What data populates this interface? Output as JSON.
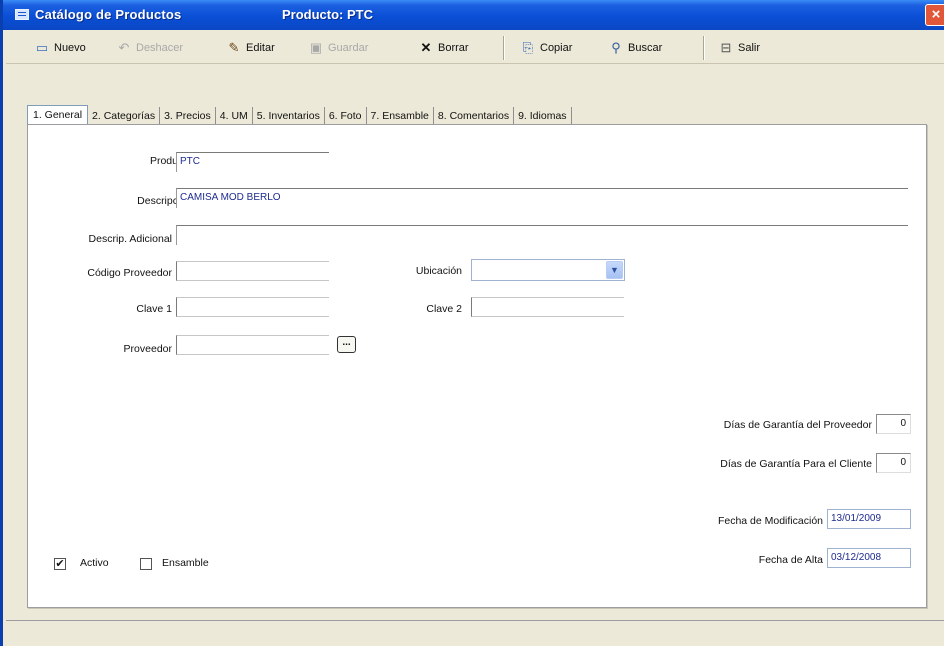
{
  "window": {
    "title": "Catálogo de Productos",
    "product_title": "Producto: PTC",
    "close_glyph": "×"
  },
  "toolbar": {
    "nuevo": "Nuevo",
    "deshacer": "Deshacer",
    "editar": "Editar",
    "guardar": "Guardar",
    "borrar": "Borrar",
    "copiar": "Copiar",
    "buscar": "Buscar",
    "salir": "Salir"
  },
  "tabs": [
    {
      "label": "1. General"
    },
    {
      "label": "2. Categorías"
    },
    {
      "label": "3. Precios"
    },
    {
      "label": "4. UM"
    },
    {
      "label": "5. Inventarios"
    },
    {
      "label": "6. Foto"
    },
    {
      "label": "7. Ensamble"
    },
    {
      "label": "8. Comentarios"
    },
    {
      "label": "9. Idiomas"
    }
  ],
  "form": {
    "producto_label": "Producto",
    "producto_value": "PTC",
    "descripcion_label": "Descripción",
    "descripcion_value": "CAMISA MOD BERLO",
    "descrip_adicional_label": "Descrip. Adicional",
    "descrip_adicional_value": "",
    "codigo_proveedor_label": "Código Proveedor",
    "codigo_proveedor_value": "",
    "ubicacion_label": "Ubicación",
    "ubicacion_value": "",
    "clave1_label": "Clave 1",
    "clave1_value": "",
    "clave2_label": "Clave 2",
    "clave2_value": "",
    "proveedor_label": "Proveedor",
    "proveedor_value": "",
    "proveedor_button": "...",
    "garantia_proveedor_label": "Días de Garantía del Proveedor",
    "garantia_proveedor_value": "0",
    "garantia_cliente_label": "Días de Garantía Para el Cliente",
    "garantia_cliente_value": "0",
    "fecha_modificacion_label": "Fecha de Modificación",
    "fecha_modificacion_value": "13/01/2009",
    "fecha_alta_label": "Fecha de Alta",
    "fecha_alta_value": "03/12/2008",
    "activo_label": "Activo",
    "activo_checked": true,
    "activo_mark": "✔",
    "ensamble_label": "Ensamble",
    "ensamble_checked": false
  },
  "colors": {
    "titlebar": "#0a4fd6",
    "value_text": "#1f2b8f",
    "window_bg": "#ece9d8"
  }
}
